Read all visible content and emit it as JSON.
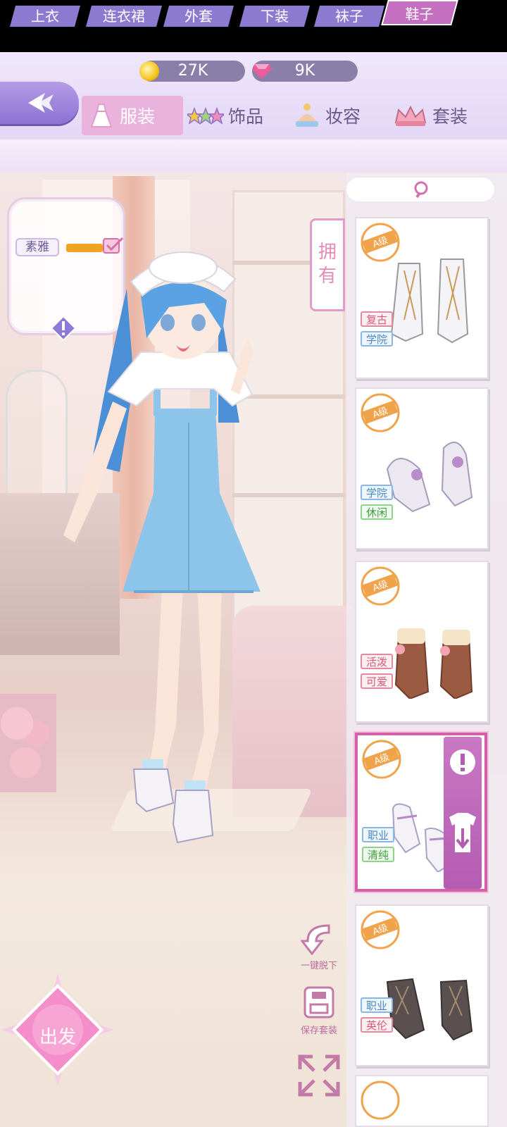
{
  "currency": {
    "coins": "27K",
    "gems": "9K",
    "coin_color": "#f4c21b",
    "gem_color": "#e64f8f"
  },
  "tabs": [
    {
      "label": "服装",
      "icon": "dress-icon",
      "active": true
    },
    {
      "label": "饰品",
      "icon": "stars-icon",
      "active": false
    },
    {
      "label": "妆容",
      "icon": "hat-icon",
      "active": false
    },
    {
      "label": "套装",
      "icon": "crown-icon",
      "active": false
    }
  ],
  "subtabs": [
    {
      "label": "上衣",
      "active": false
    },
    {
      "label": "连衣裙",
      "active": false
    },
    {
      "label": "外套",
      "active": false
    },
    {
      "label": "下装",
      "active": false
    },
    {
      "label": "袜子",
      "active": false
    },
    {
      "label": "鞋子",
      "active": true
    }
  ],
  "style_card": {
    "style_label": "素雅",
    "bar_color": "#f1a324"
  },
  "owned_button": {
    "label": "拥有"
  },
  "actions": {
    "undress_label": "一键脱下",
    "save_label": "保存套装",
    "depart_label": "出发"
  },
  "items": [
    {
      "grade": "A级",
      "tags": [
        "复古",
        "学院"
      ],
      "tag_styles": [
        "pink",
        "blue"
      ],
      "shoe": "white-lace-boots"
    },
    {
      "grade": "A级",
      "tags": [
        "学院",
        "休闲"
      ],
      "tag_styles": [
        "blue",
        "green"
      ],
      "shoe": "lavender-pumps"
    },
    {
      "grade": "A级",
      "tags": [
        "活泼",
        "可爱"
      ],
      "tag_styles": [
        "pink",
        "pink"
      ],
      "shoe": "brown-bow-boots"
    },
    {
      "grade": "A级",
      "tags": [
        "职业",
        "清纯"
      ],
      "tag_styles": [
        "blue",
        "green"
      ],
      "shoe": "white-mary-janes",
      "selected": true
    },
    {
      "grade": "A级",
      "tags": [
        "职业",
        "英伦"
      ],
      "tag_styles": [
        "blue",
        "pink"
      ],
      "shoe": "dark-brogue-boots"
    }
  ]
}
